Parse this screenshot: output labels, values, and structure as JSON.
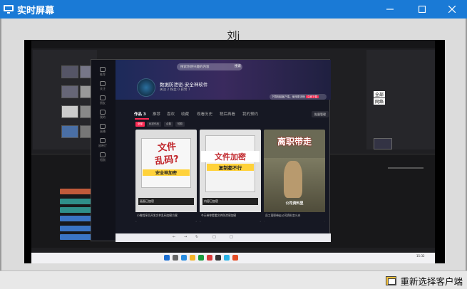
{
  "window": {
    "title": "实时屏幕"
  },
  "viewer": {
    "client_name": "刘j",
    "reselect_label": "重新选择客户端"
  },
  "remote": {
    "app": {
      "search_placeholder": "搜索你感兴趣的内容",
      "search_button": "搜索",
      "channel_name": "数据防泄密-安全神软件",
      "stats": "关注 2    粉丝 0    获赞 7",
      "promo": "下载电脑客户端，使用更流畅",
      "promo_button": "立即下载",
      "tabs": [
        "作品 3",
        "推荐",
        "喜欢",
        "收藏",
        "观看历史",
        "稍后再看",
        "我的预约"
      ],
      "batch_button": "批量管理",
      "filters": [
        "全部",
        "私密作品",
        "合集",
        "短剧"
      ],
      "sidebar_items": [
        "推荐",
        "关注",
        "朋友",
        "我的",
        "直播",
        "放映厅",
        "短剧"
      ],
      "cards": [
        {
          "headline_1": "文件",
          "headline_2": "乱码?",
          "sub": "安全神加密",
          "caption": "小微程序员开发文件乱码加密方案"
        },
        {
          "headline_1": "文件加密",
          "headline_2": "",
          "sub": "复制都不行",
          "caption": "今天带你看看文件防泄密加密"
        },
        {
          "headline_1": "离职带走",
          "headline_2": "",
          "sub": "公司资料里",
          "caption": "员工离职带走公司资料怎么办"
        }
      ],
      "cover_tags": [
        "画面已加密",
        "内容已加密",
        "公司资料"
      ]
    },
    "right_panel": [
      "全部",
      "网络"
    ],
    "tray_clock": "15:32"
  },
  "colors": {
    "titlebar": "#1a7ad6",
    "accent": "#fe2c55"
  }
}
